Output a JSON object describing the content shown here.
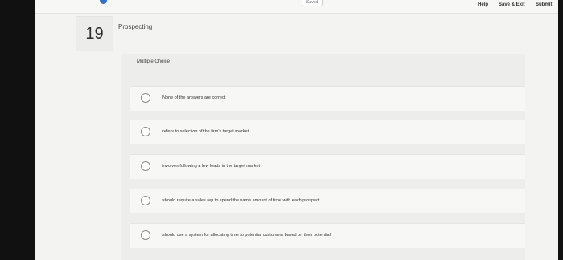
{
  "header": {
    "nav_remnant": "...",
    "saved_label": "Saved",
    "help_label": "Help",
    "save_exit_label": "Save & Exit",
    "submit_label": "Submit"
  },
  "question": {
    "number": "19",
    "topic": "Prospecting",
    "type": "Multiple Choice",
    "choices": [
      {
        "text": "None of the answers are correct"
      },
      {
        "text": "refers to selection of the firm's target market"
      },
      {
        "text": "involves following a few leads in the target market"
      },
      {
        "text": "should require a sales rep to spend the same amount of time with each prospect"
      },
      {
        "text": "should use a system for allocating time to potential customers based on their potential"
      }
    ]
  },
  "colors": {
    "accent": "#2f6fcf",
    "background": "#f3f3f1"
  }
}
